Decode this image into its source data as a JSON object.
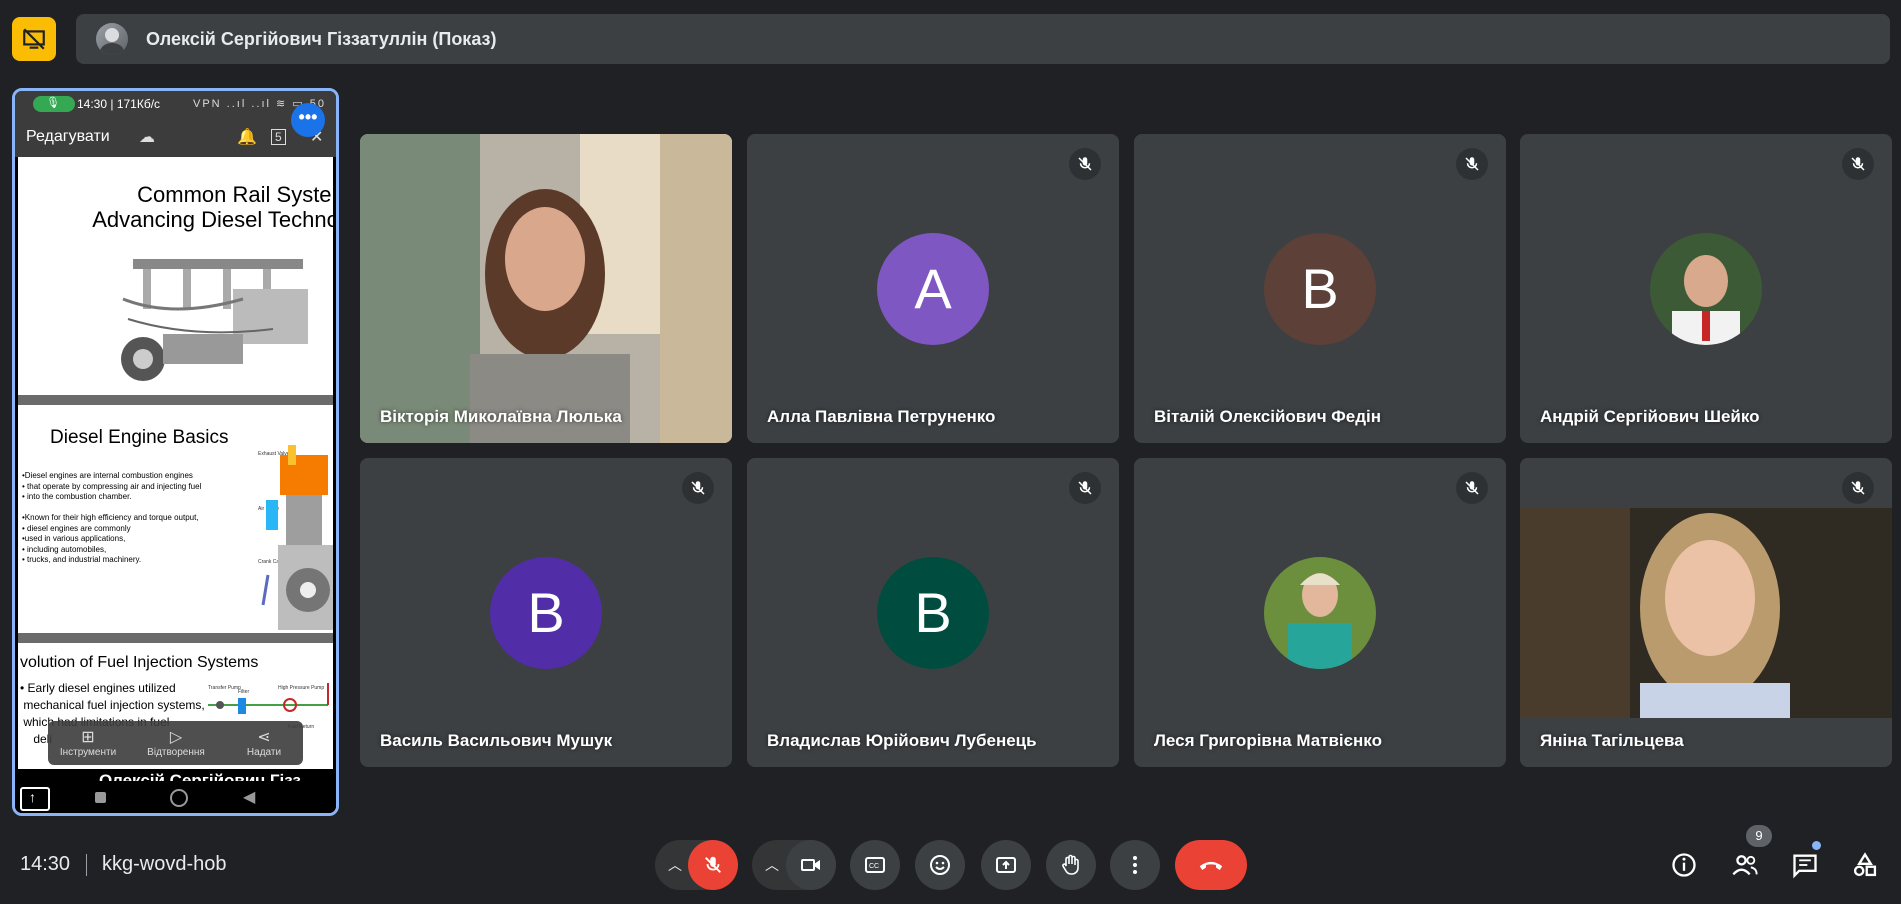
{
  "header": {
    "presenter_title": "Олексій Сергійович Гіззатуллін (Показ)"
  },
  "presenter_tile": {
    "status_bar": "14:30 | 171Кб/с",
    "status_icons": "VPN ..ıl ..ıl ≋ ▭ 50",
    "edit_label": "Редагувати",
    "more_label": "•••",
    "slide1_title_line1": "Common Rail System:",
    "slide1_title_line2": "Advancing Diesel Technolo",
    "slide2_title": "Diesel Engine Basics",
    "slide2_body": "•Diesel engines are internal combustion engines\n• that operate by compressing air and injecting fuel\n• into the combustion chamber.\n\n•Known for their high efficiency and torque output,\n• diesel engines are commonly\n•used in various applications,\n• including automobiles,\n• trucks, and industrial machinery.",
    "slide2_labels": [
      "Exhaust Valve",
      "Air Intake",
      "Crank Case"
    ],
    "slide3_title": "volution of Fuel Injection Systems",
    "slide3_body": "• Early diesel engines utilized\n mechanical fuel injection systems,\n which had limitations in fuel\n    deli",
    "slide3_labels": [
      "Transfer Pump",
      "Filter",
      "High Pressure Pump",
      "Fuel Return"
    ],
    "popup": [
      {
        "icon": "tools-icon",
        "label": "Інструменти"
      },
      {
        "icon": "play-icon",
        "label": "Відтворення"
      },
      {
        "icon": "share-icon",
        "label": "Надати"
      }
    ],
    "name": "Олексій Сергійович Гізз..."
  },
  "participants": [
    {
      "name": "Вікторія Миколаївна Люлька",
      "type": "video",
      "muted": false
    },
    {
      "name": "Алла Павлівна Петруненко",
      "type": "letter",
      "letter": "А",
      "color": "#7e57c2",
      "muted": true
    },
    {
      "name": "Віталій Олексійович Федін",
      "type": "letter",
      "letter": "В",
      "color": "#5d4037",
      "muted": true
    },
    {
      "name": "Андрій Сергійович Шейко",
      "type": "photo",
      "muted": true
    },
    {
      "name": "Василь Васильович Мушук",
      "type": "letter",
      "letter": "В",
      "color": "#512da8",
      "muted": true
    },
    {
      "name": "Владислав Юрійович Лубенець",
      "type": "letter",
      "letter": "В",
      "color": "#004d40",
      "muted": true
    },
    {
      "name": "Леся Григорівна Матвієнко",
      "type": "photo",
      "muted": true
    },
    {
      "name": "Яніна Тагільцева",
      "type": "video",
      "muted": true
    }
  ],
  "bottom_bar": {
    "time": "14:30",
    "meeting_code": "kkg-wovd-hob",
    "participants_count": "9"
  },
  "colors": {
    "background": "#202124",
    "tile": "#3c4043",
    "accent_blue": "#8ab4f8",
    "red": "#ea4335",
    "yellow": "#fbbc04"
  }
}
